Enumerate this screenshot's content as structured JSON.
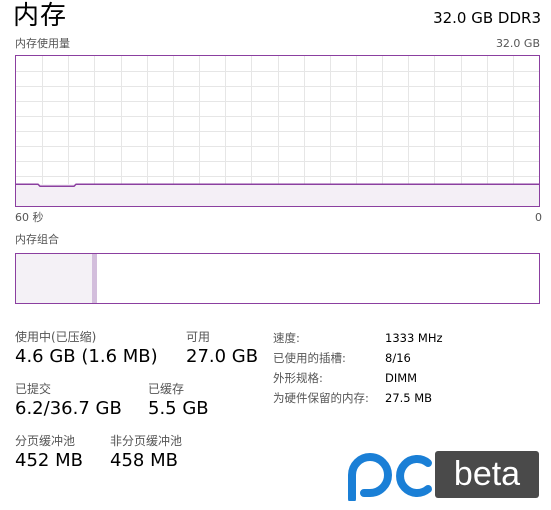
{
  "header": {
    "title": "内存",
    "spec": "32.0 GB DDR3"
  },
  "usage_graph": {
    "label": "内存使用量",
    "max_label": "32.0 GB",
    "time_left": "60 秒",
    "time_right": "0",
    "line_color": "#8b3fa0",
    "fill_color": "#f4eff6",
    "grid_color": "#e6e6e6",
    "usage_fraction": 0.145
  },
  "composition": {
    "label": "内存组合",
    "segments": [
      {
        "name": "in-use",
        "fraction": 0.145,
        "color": "#f4f1f6"
      },
      {
        "name": "modified",
        "fraction": 0.01,
        "color": "#d3bedc"
      },
      {
        "name": "standby",
        "fraction": 0.172,
        "color": "#ffffff"
      },
      {
        "name": "free",
        "fraction": 0.673,
        "color": "#ffffff"
      }
    ]
  },
  "stats": {
    "in_use": {
      "label": "使用中(已压缩)",
      "value": "4.6 GB (1.6 MB)"
    },
    "available": {
      "label": "可用",
      "value": "27.0 GB"
    },
    "committed": {
      "label": "已提交",
      "value": "6.2/36.7 GB"
    },
    "cached": {
      "label": "已缓存",
      "value": "5.5 GB"
    },
    "paged_pool": {
      "label": "分页缓冲池",
      "value": "452 MB"
    },
    "nonpaged_pool": {
      "label": "非分页缓冲池",
      "value": "458 MB"
    }
  },
  "details": [
    {
      "key": "速度:",
      "value": "1333 MHz"
    },
    {
      "key": "已使用的插槽:",
      "value": "8/16"
    },
    {
      "key": "外形规格:",
      "value": "DIMM"
    },
    {
      "key": "为硬件保留的内存:",
      "value": "27.5 MB"
    }
  ],
  "logo": {
    "brand_color": "#1a7fd6",
    "box_color": "#4a4a4a",
    "text": "beta"
  }
}
